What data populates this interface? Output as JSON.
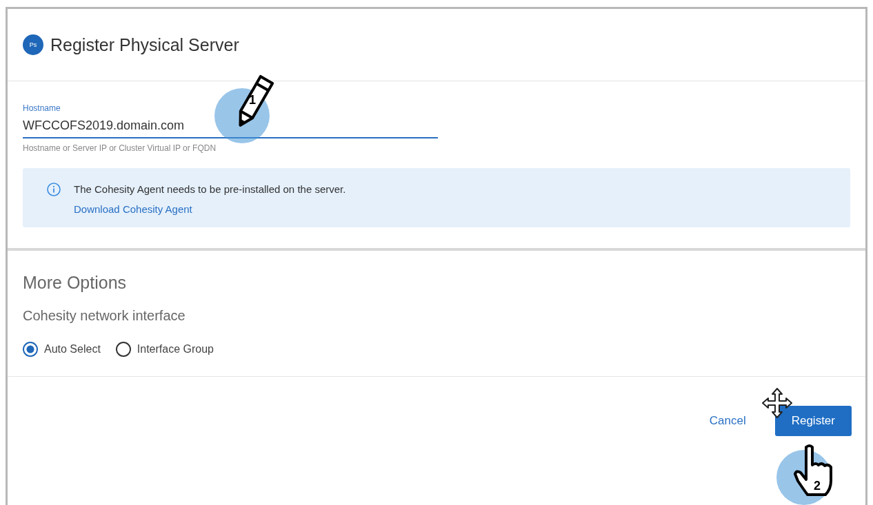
{
  "dialog": {
    "badge": "Ps",
    "title": "Register Physical Server"
  },
  "hostname": {
    "label": "Hostname",
    "value": "WFCCOFS2019.domain.com",
    "hint": "Hostname or Server IP or Cluster Virtual IP or FQDN"
  },
  "notice": {
    "text": "The Cohesity Agent needs to be pre-installed on the server.",
    "link": "Download Cohesity Agent"
  },
  "more_options": {
    "title": "More Options",
    "subtitle": "Cohesity network interface",
    "options": [
      {
        "label": "Auto Select",
        "selected": true
      },
      {
        "label": "Interface Group",
        "selected": false
      }
    ]
  },
  "buttons": [
    {
      "label": "Cancel",
      "kind": "text"
    },
    {
      "label": "Register",
      "kind": "primary"
    }
  ],
  "annotations": [
    {
      "kind": "pencil",
      "label": "1"
    },
    {
      "kind": "hand",
      "label": "2"
    },
    {
      "kind": "move"
    }
  ]
}
